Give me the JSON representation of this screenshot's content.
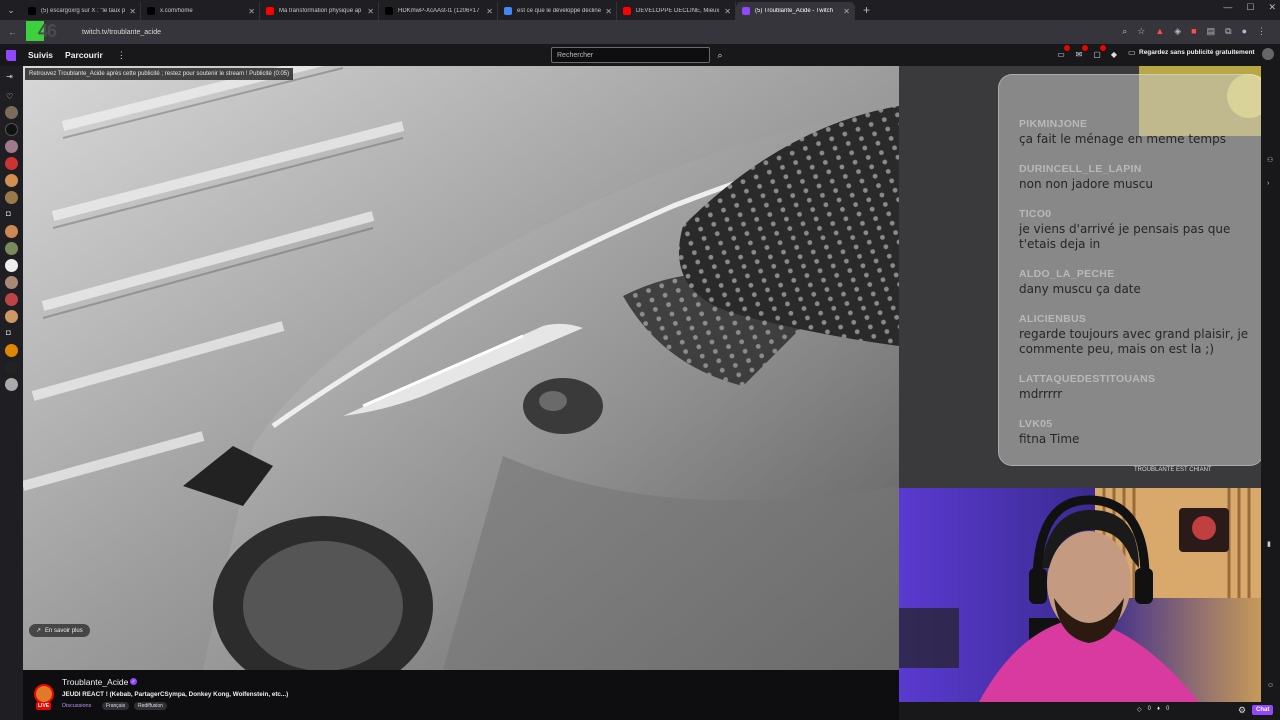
{
  "browser": {
    "tabs": [
      {
        "title": "(5) escargoxrg sur X : \"le taux pl",
        "icon": "x-icon",
        "color": "#000000",
        "active": false
      },
      {
        "title": "x.com/home",
        "icon": "x-icon",
        "color": "#000000",
        "active": false
      },
      {
        "title": "Ma transformation physique ap",
        "icon": "youtube-icon",
        "color": "#ff0000",
        "active": false
      },
      {
        "title": "HDKmwP-XcAAst-l1 (1206×17",
        "icon": "x-icon",
        "color": "#000000",
        "active": false
      },
      {
        "title": "est ce que le développé décline",
        "icon": "google-icon",
        "color": "#4285f4",
        "active": false
      },
      {
        "title": "DÉVELOPPÉ DÉCLINÉ, Mieux qu",
        "icon": "youtube-icon",
        "color": "#ff0000",
        "active": false
      },
      {
        "title": "(5) Troublante_Acide - Twitch",
        "icon": "twitch-icon",
        "color": "#9147ff",
        "active": true
      }
    ],
    "url": "twitch.tv/troublante_acide"
  },
  "twitch_nav": {
    "following": "Suivis",
    "browse": "Parcourir",
    "search_placeholder": "Rechercher",
    "ad_free": "Regardez sans publicité gratuitement"
  },
  "player": {
    "ad_notice": "Retrouvez Troublante_Acide après cette publicité ; restez pour soutenir le stream ! Publicité (0:05)",
    "learn_more": "En savoir plus"
  },
  "chat_overlay": {
    "messages": [
      {
        "user": "PIKMINJONE",
        "text": "ça fait le ménage en meme temps"
      },
      {
        "user": "DURINCELL_LE_LAPIN",
        "text": "non non jadore muscu"
      },
      {
        "user": "TICO0",
        "text": "je viens d'arrivé je pensais pas que t'etais deja in"
      },
      {
        "user": "ALDO_LA_PECHE",
        "text": "dany muscu ça date"
      },
      {
        "user": "ALICIENBUS",
        "text": "regarde toujours avec grand plaisir, je commente peu, mais on est la ;)"
      },
      {
        "user": "LATTAQUEDESTITOUANS",
        "text": "mdrrrrr"
      },
      {
        "user": "LVK05",
        "text": "fitna Time"
      }
    ]
  },
  "side_chat_fragment": {
    "text": "TROUBLANTE EST CHIANT"
  },
  "stream_info": {
    "channel": "Troublante_Acide",
    "title": "JEUDI REACT ! (Kebab, PartagerCSympa, Donkey Kong, Wolfenstein, etc...)",
    "category": "Discussions",
    "tags": [
      "Français",
      "Rediffusion"
    ],
    "live_badge": "LIVE"
  },
  "chat_footer": {
    "points": "0",
    "bits": "0",
    "send_label": "Chat"
  }
}
